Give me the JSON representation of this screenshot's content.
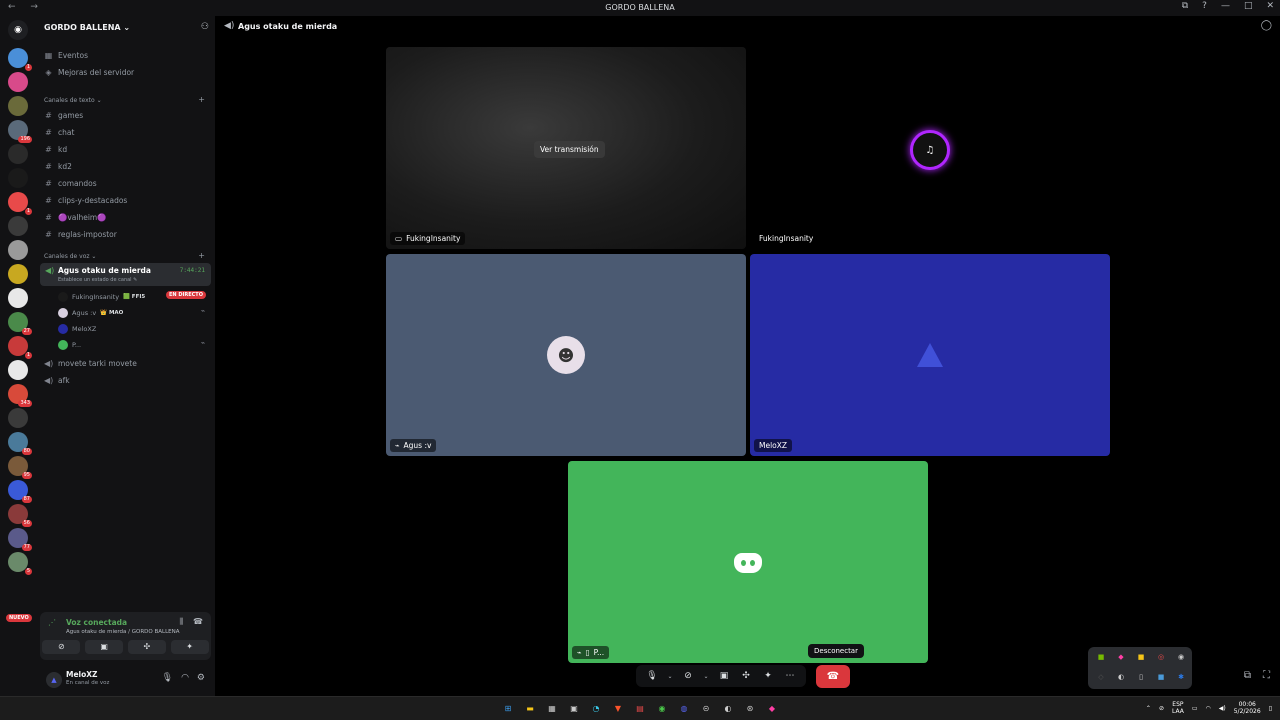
{
  "window": {
    "title": "GORDO BALLENA",
    "nav": "← →",
    "controls": [
      "⧉",
      "?",
      "—",
      "□",
      "✕"
    ]
  },
  "servers": {
    "items": [
      {
        "badge": "1",
        "color": "#4a8fd8"
      },
      {
        "badge": "",
        "color": "#d84a8a"
      },
      {
        "badge": "",
        "color": "#6a6a3a"
      },
      {
        "badge": "196",
        "color": "#5a6a7a"
      },
      {
        "badge": "",
        "color": "#2a2a2a"
      },
      {
        "badge": "",
        "color": "#1a1a1a"
      },
      {
        "badge": "1",
        "color": "#e84a4a"
      },
      {
        "badge": "",
        "color": "#3a3a3a"
      },
      {
        "badge": "",
        "color": "#9a9a9a"
      },
      {
        "badge": "",
        "color": "#c8a820"
      },
      {
        "badge": "",
        "color": "#e8e8e8"
      },
      {
        "badge": "27",
        "color": "#4a8a4a"
      },
      {
        "badge": "1",
        "color": "#c83a3a"
      },
      {
        "badge": "",
        "color": "#e8e8e8"
      },
      {
        "badge": "343",
        "color": "#d84a3a"
      },
      {
        "badge": "",
        "color": "#3a3a3a"
      },
      {
        "badge": "80",
        "color": "#4a7a9a"
      },
      {
        "badge": "95",
        "color": "#7a5a3a"
      },
      {
        "badge": "87",
        "color": "#3a5ad8"
      },
      {
        "badge": "56",
        "color": "#8a3a3a"
      },
      {
        "badge": "77",
        "color": "#5a5a8a"
      },
      {
        "badge": "5",
        "color": "#6a8a6a"
      }
    ],
    "nuevo": "NUEVO"
  },
  "sidebar": {
    "guild_name": "GORDO BALLENA ⌄",
    "top_items": [
      {
        "icon": "▦",
        "label": "Eventos"
      },
      {
        "icon": "◈",
        "label": "Mejoras del servidor"
      }
    ],
    "text_category": "Canales de texto ⌄",
    "text_channels": [
      "games",
      "chat",
      "kd",
      "kd2",
      "comandos",
      "clips-y-destacados",
      "🟣valheim🟣",
      "reglas-impostor"
    ],
    "voice_category": "Canales de voz ⌄",
    "active_voice": {
      "name": "Agus otaku de mierda",
      "status": "Establece un estado de canal ✎",
      "time": "7:44:21"
    },
    "voice_users": [
      {
        "name": "FukingInsanity",
        "tag": "🟩 FFI5",
        "live": true
      },
      {
        "name": "Agus :v",
        "tag": "👑 MAO",
        "live": false
      },
      {
        "name": "MeloXZ",
        "tag": "",
        "live": false
      },
      {
        "name": "P...",
        "tag": "",
        "live": false
      }
    ],
    "live_label": "EN DIRECTO",
    "other_voice": [
      "movete tarki movete",
      "afk"
    ]
  },
  "voice_panel": {
    "status": "Voz conectada",
    "location": "Agus otaku de mierda / GORDO BALLENA"
  },
  "user_panel": {
    "name": "MeloXZ",
    "status": "En canal de voz"
  },
  "header": {
    "channel": "Agus otaku de mierda"
  },
  "stage": {
    "tiles": [
      {
        "name": "FukingInsanity",
        "type": "stream",
        "button": "Ver transmisión"
      },
      {
        "name": "FukingInsanity",
        "type": "avatar"
      },
      {
        "name": "Agus :v",
        "type": "avatar"
      },
      {
        "name": "MeloXZ",
        "type": "avatar"
      },
      {
        "name": "P...",
        "type": "discord"
      }
    ]
  },
  "callbar": {
    "tooltip": "Desconectar"
  },
  "taskbar": {
    "lang": "ESP",
    "lang2": "LAA",
    "time": "00:06",
    "date": "5/2/2026"
  },
  "colors": {
    "accent": "#5865f2",
    "online": "#57a85c",
    "danger": "#da373c",
    "tile_gray": "#4b5a72",
    "tile_blue": "#262ba4",
    "tile_green": "#43b55a"
  }
}
